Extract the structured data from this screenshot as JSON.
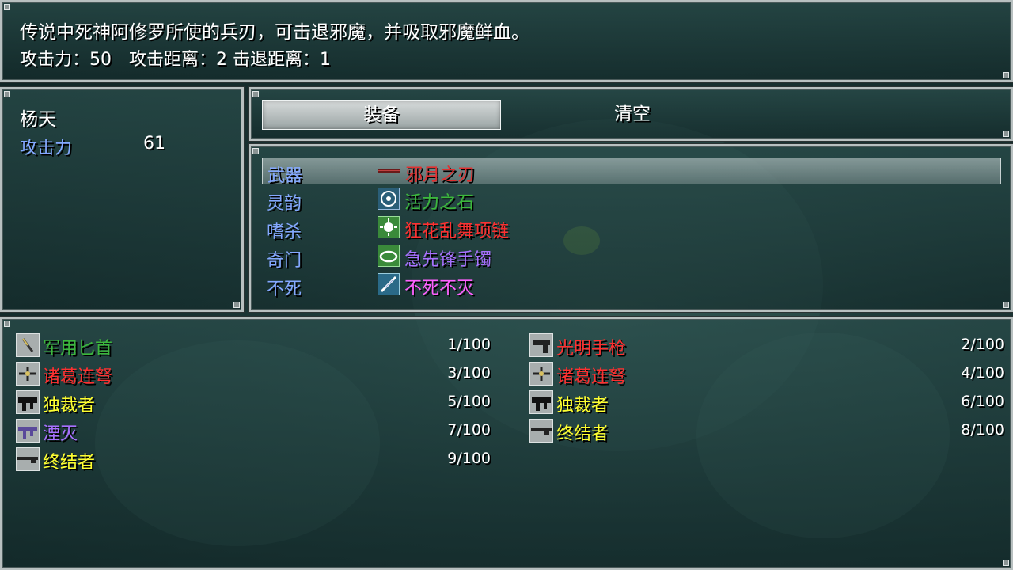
{
  "help": {
    "line1": "传说中死神阿修罗所使的兵刃，可击退邪魔，并吸取邪魔鲜血。",
    "line2": "攻击力：50　攻击距离：2 击退距离：1"
  },
  "status": {
    "actor_name": "杨天",
    "stat_label": "攻击力",
    "stat_value": "61"
  },
  "commands": {
    "equip": "装备",
    "clear": "清空"
  },
  "slots": [
    {
      "type": "武器",
      "item": "邪月之刃",
      "color": "#e03030",
      "icon": "blade-icon"
    },
    {
      "type": "灵韵",
      "item": "活力之石",
      "color": "#3cb83c",
      "icon": "stone-icon"
    },
    {
      "type": "嗜杀",
      "item": "狂花乱舞项链",
      "color": "#ff3030",
      "icon": "necklace-icon"
    },
    {
      "type": "奇门",
      "item": "急先锋手镯",
      "color": "#a870ff",
      "icon": "bracelet-icon"
    },
    {
      "type": "不死",
      "item": "不死不灭",
      "color": "#ff60ff",
      "icon": "feather-icon"
    }
  ],
  "items": [
    {
      "name": "军用匕首",
      "count": "1/100",
      "color": "#3cb83c",
      "icon": "dagger-icon"
    },
    {
      "name": "光明手枪",
      "count": "2/100",
      "color": "#ff3030",
      "icon": "pistol-icon"
    },
    {
      "name": "诸葛连弩",
      "count": "3/100",
      "color": "#ff3030",
      "icon": "crossbow-icon"
    },
    {
      "name": "诸葛连弩",
      "count": "4/100",
      "color": "#ff3030",
      "icon": "crossbow-icon"
    },
    {
      "name": "独裁者",
      "count": "5/100",
      "color": "#ffff30",
      "icon": "smg-icon"
    },
    {
      "name": "独裁者",
      "count": "6/100",
      "color": "#ffff30",
      "icon": "smg-icon"
    },
    {
      "name": "湮灭",
      "count": "7/100",
      "color": "#a870ff",
      "icon": "smg-purple-icon"
    },
    {
      "name": "终结者",
      "count": "8/100",
      "color": "#ffff30",
      "icon": "rifle-icon"
    },
    {
      "name": "终结者",
      "count": "9/100",
      "color": "#ffff30",
      "icon": "rifle-icon"
    }
  ]
}
